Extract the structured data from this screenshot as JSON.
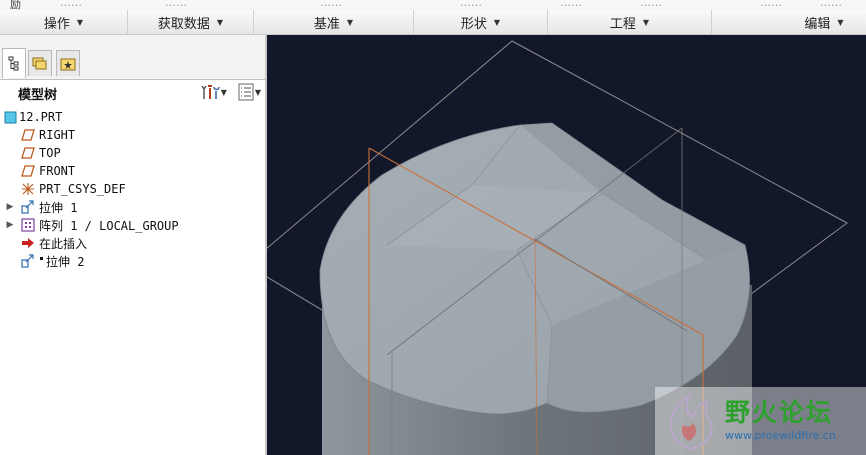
{
  "ribbon_top": {
    "fragments": [
      "励",
      "……",
      "……",
      "……",
      "……",
      "……",
      "……",
      "……",
      "……"
    ]
  },
  "groups": [
    {
      "label": "操作"
    },
    {
      "label": "获取数据"
    },
    {
      "label": "基准"
    },
    {
      "label": "形状"
    },
    {
      "label": "工程"
    },
    {
      "label": "编辑"
    }
  ],
  "model_tree": {
    "title": "模型树",
    "items": [
      {
        "label": "12.PRT",
        "icon": "part-icon",
        "expandable": false
      },
      {
        "label": "RIGHT",
        "icon": "datum-plane-icon",
        "expandable": false
      },
      {
        "label": "TOP",
        "icon": "datum-plane-icon",
        "expandable": false
      },
      {
        "label": "FRONT",
        "icon": "datum-plane-icon",
        "expandable": false
      },
      {
        "label": "PRT_CSYS_DEF",
        "icon": "coordinate-system-icon",
        "expandable": false
      },
      {
        "label": "拉伸 1",
        "icon": "extrude-icon",
        "expandable": true
      },
      {
        "label": "阵列 1 / LOCAL_GROUP",
        "icon": "pattern-icon",
        "expandable": true
      },
      {
        "label": "在此插入",
        "icon": "insert-here-arrow-icon",
        "expandable": false
      },
      {
        "label": "拉伸 2",
        "icon": "extrude-icon",
        "expandable": false
      }
    ]
  },
  "watermark": {
    "title": "野火论坛",
    "url": "www.proewildfire.cn"
  },
  "colors": {
    "viewport_bg": "#12172a",
    "model_face": "#9aa3aa",
    "datum_plane_edge": "#c9713a",
    "watermark_green": "#2da02d"
  }
}
